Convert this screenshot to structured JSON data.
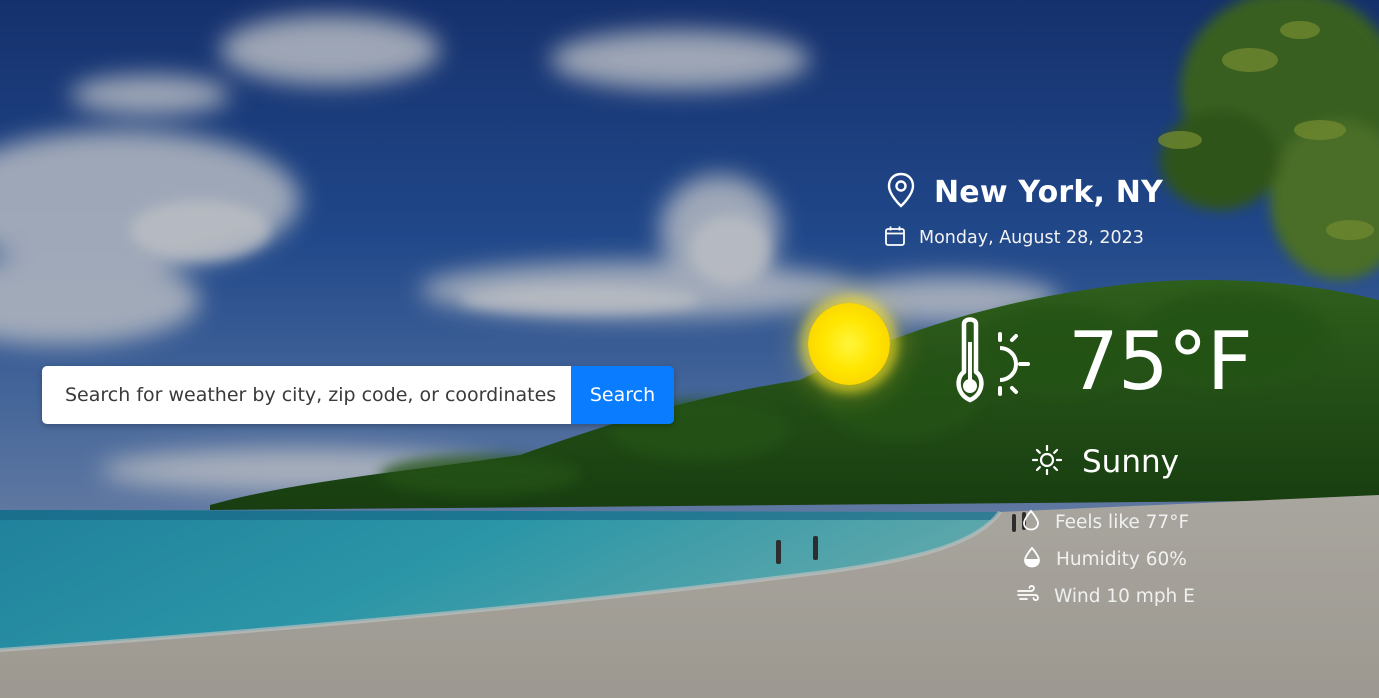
{
  "search": {
    "placeholder": "Search for weather by city, zip code, or coordinates",
    "button_label": "Search"
  },
  "weather": {
    "location": "New York, NY",
    "date": "Monday, August 28, 2023",
    "temperature": "75°F",
    "condition": "Sunny",
    "feels_like": "Feels like 77°F",
    "humidity": "Humidity 60%",
    "wind": "Wind 10 mph E"
  },
  "icons": {
    "location": "map-pin-icon",
    "date": "calendar-icon",
    "temperature": "thermometer-sun-icon",
    "condition": "sun-icon",
    "feels_like": "droplet-outline-icon",
    "humidity": "droplet-half-icon",
    "wind": "wind-icon"
  },
  "colors": {
    "search_button": "#0a7cff",
    "sun": "#ffe600",
    "text": "#ffffff"
  }
}
